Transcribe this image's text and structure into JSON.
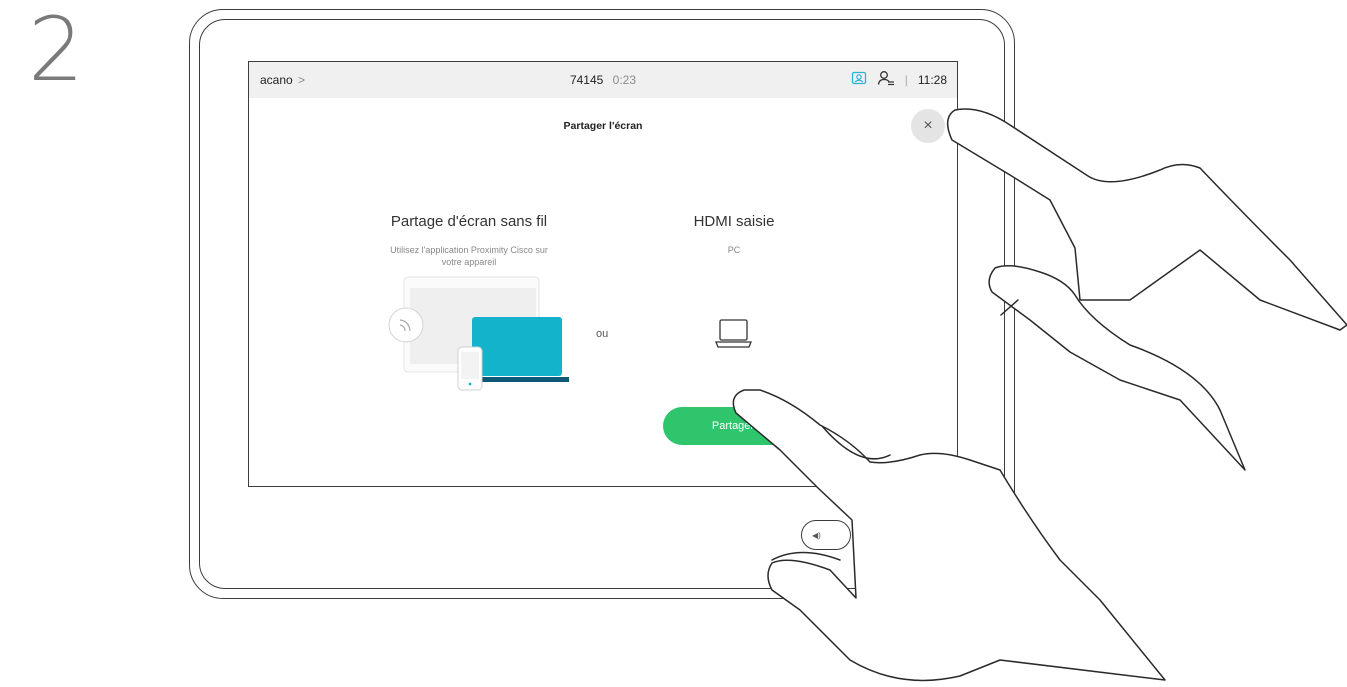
{
  "step": {
    "number": "2"
  },
  "status_bar": {
    "caller": "acano",
    "caller_chevron": ">",
    "call_number": "74145",
    "call_duration": "0:23",
    "separator": "|",
    "time": "11:28",
    "icons": [
      "camera-self-view-icon",
      "person-list-icon"
    ],
    "accent_color": "#2fb1dd"
  },
  "panel": {
    "title": "Partager l'écran",
    "close_icon": "close-icon",
    "close_symbol": "×",
    "wireless": {
      "title": "Partage d'écran sans fil",
      "subtitle_line1": "Utilisez l'application Proximity Cisco sur",
      "subtitle_line2": "votre appareil",
      "icons": [
        "wireless-signal-icon",
        "laptop-illustration",
        "phone-illustration"
      ]
    },
    "separator_text": "ou",
    "hdmi": {
      "title": "HDMI saisie",
      "subtitle": "PC",
      "icon": "laptop-icon"
    },
    "share_button": {
      "label": "Partager",
      "color": "#2fc56c"
    }
  },
  "device": {
    "volume_icon": "speaker-icon",
    "volume_symbol": "◀)"
  },
  "colors": {
    "illustration_laptop": "#13b3cc",
    "illustration_laptop_base": "#0d5a78",
    "status_bar_bg": "#f0f0f0"
  }
}
